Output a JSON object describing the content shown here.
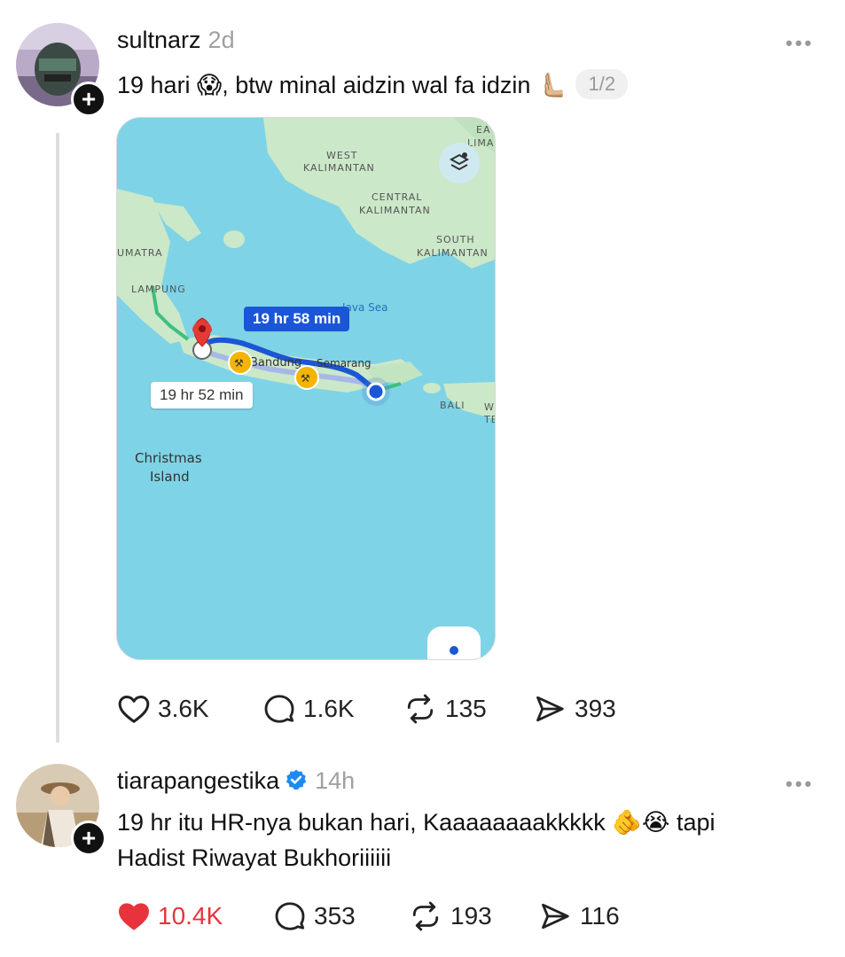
{
  "post1": {
    "username": "sultnarz",
    "time": "2d",
    "text": "19 hari 😱, btw minal aidzin wal fa idzin 🫷🏼",
    "page_indicator": "1/2",
    "map": {
      "labels": {
        "west_kalimantan_1": "WEST",
        "west_kalimantan_2": "KALIMANTAN",
        "central_kalimantan_1": "CENTRAL",
        "central_kalimantan_2": "KALIMANTAN",
        "south_kalimantan_1": "SOUTH",
        "south_kalimantan_2": "KALIMANTAN",
        "east_kalimantan_1": "EA",
        "east_kalimantan_2": "LIMA",
        "sumatra": "UMATRA",
        "lampung": "LAMPUNG",
        "java_sea": "Java Sea",
        "bandung": "Bandung",
        "semarang": "Semarang",
        "bali": "BALI",
        "w": "W",
        "te": "TE",
        "christmas_1": "Christmas",
        "christmas_2": "Island"
      },
      "route_primary": "19 hr 58 min",
      "route_alt": "19 hr 52 min"
    },
    "actions": {
      "likes": "3.6K",
      "comments": "1.6K",
      "reposts": "135",
      "shares": "393"
    }
  },
  "post2": {
    "username": "tiarapangestika",
    "time": "14h",
    "text_line1": "19 hr itu HR-nya bukan hari, Kaaaaaaaakkkkk 🫵😭 tapi",
    "text_line2": "Hadist Riwayat Bukhoriiiiii",
    "actions": {
      "likes": "10.4K",
      "comments": "353",
      "reposts": "193",
      "shares": "116"
    }
  },
  "colors": {
    "like_active": "#e8333c",
    "route_blue": "#1a56d6",
    "sea": "#7fd3e6",
    "land": "#cbe8c9",
    "verified": "#1d8bf1"
  },
  "icons": [
    "plus-icon",
    "more-icon",
    "heart-icon",
    "comment-icon",
    "repost-icon",
    "share-icon",
    "verified-icon",
    "layers-icon",
    "location-pin-icon",
    "roadwork-icon",
    "my-location-icon"
  ]
}
